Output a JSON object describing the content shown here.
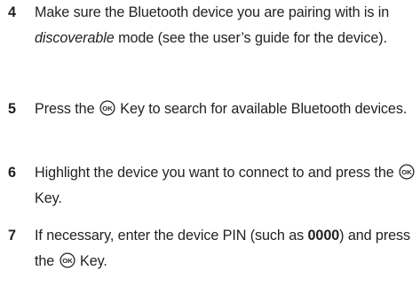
{
  "steps": [
    {
      "number": "4",
      "text_a": "Make sure the Bluetooth device you are pairing with is in ",
      "em": "discoverable",
      "text_b": " mode (see the user’s guide for the device)."
    },
    {
      "number": "5",
      "text_a": "Press the ",
      "key_label": "OK",
      "text_b": " Key to search for available Bluetooth devices."
    },
    {
      "number": "6",
      "text_a": "Highlight the device you want to connect to and press the ",
      "key_label": "OK",
      "text_b": " Key."
    },
    {
      "number": "7",
      "text_a": "If necessary, enter the device PIN (such as ",
      "bold": "0000",
      "text_b": ") and press the ",
      "key_label": "OK",
      "text_c": " Key."
    }
  ],
  "icons": {
    "ok_key": "ok-key-icon"
  }
}
